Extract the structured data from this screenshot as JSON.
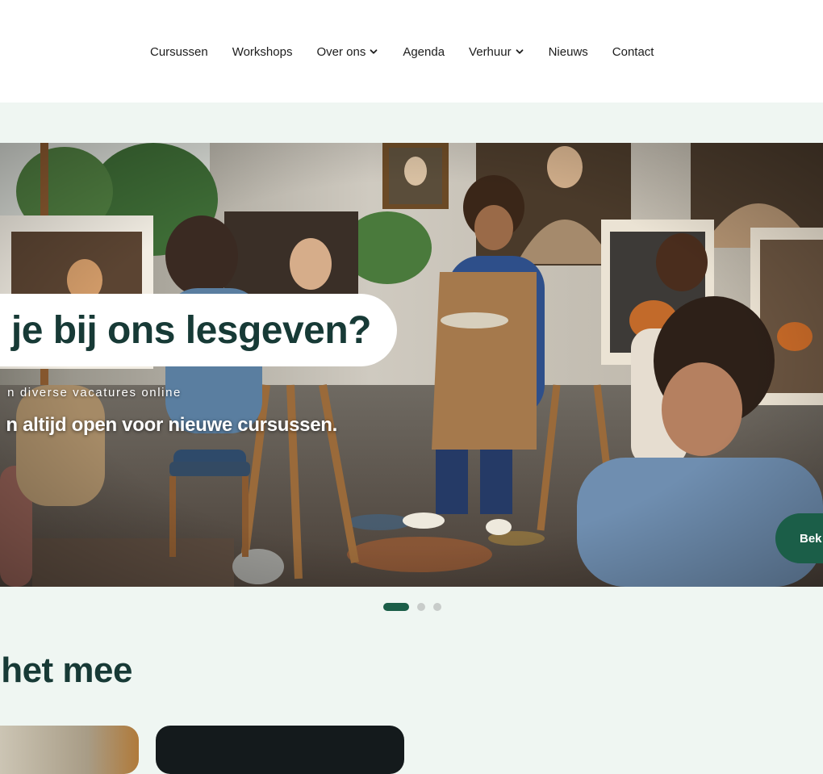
{
  "nav": {
    "items": [
      {
        "label": "Cursussen",
        "dropdown": false
      },
      {
        "label": "Workshops",
        "dropdown": false
      },
      {
        "label": "Over ons",
        "dropdown": true
      },
      {
        "label": "Agenda",
        "dropdown": false
      },
      {
        "label": "Verhuur",
        "dropdown": true
      },
      {
        "label": "Nieuws",
        "dropdown": false
      },
      {
        "label": "Contact",
        "dropdown": false
      }
    ]
  },
  "hero": {
    "title": "m je bij ons lesgeven?",
    "kicker": "n diverse vacatures online",
    "subtitle": "n altijd open voor nieuwe cursussen.",
    "cta_label": "Bek",
    "image": "painting-class-photo",
    "slides": {
      "count": 3,
      "active": 1
    }
  },
  "section": {
    "heading": "het mee"
  },
  "colors": {
    "brand_dark": "#173a36",
    "brand_green": "#1b5e48",
    "page_bg": "#eff6f2",
    "dot_inactive": "#c8ccca"
  }
}
